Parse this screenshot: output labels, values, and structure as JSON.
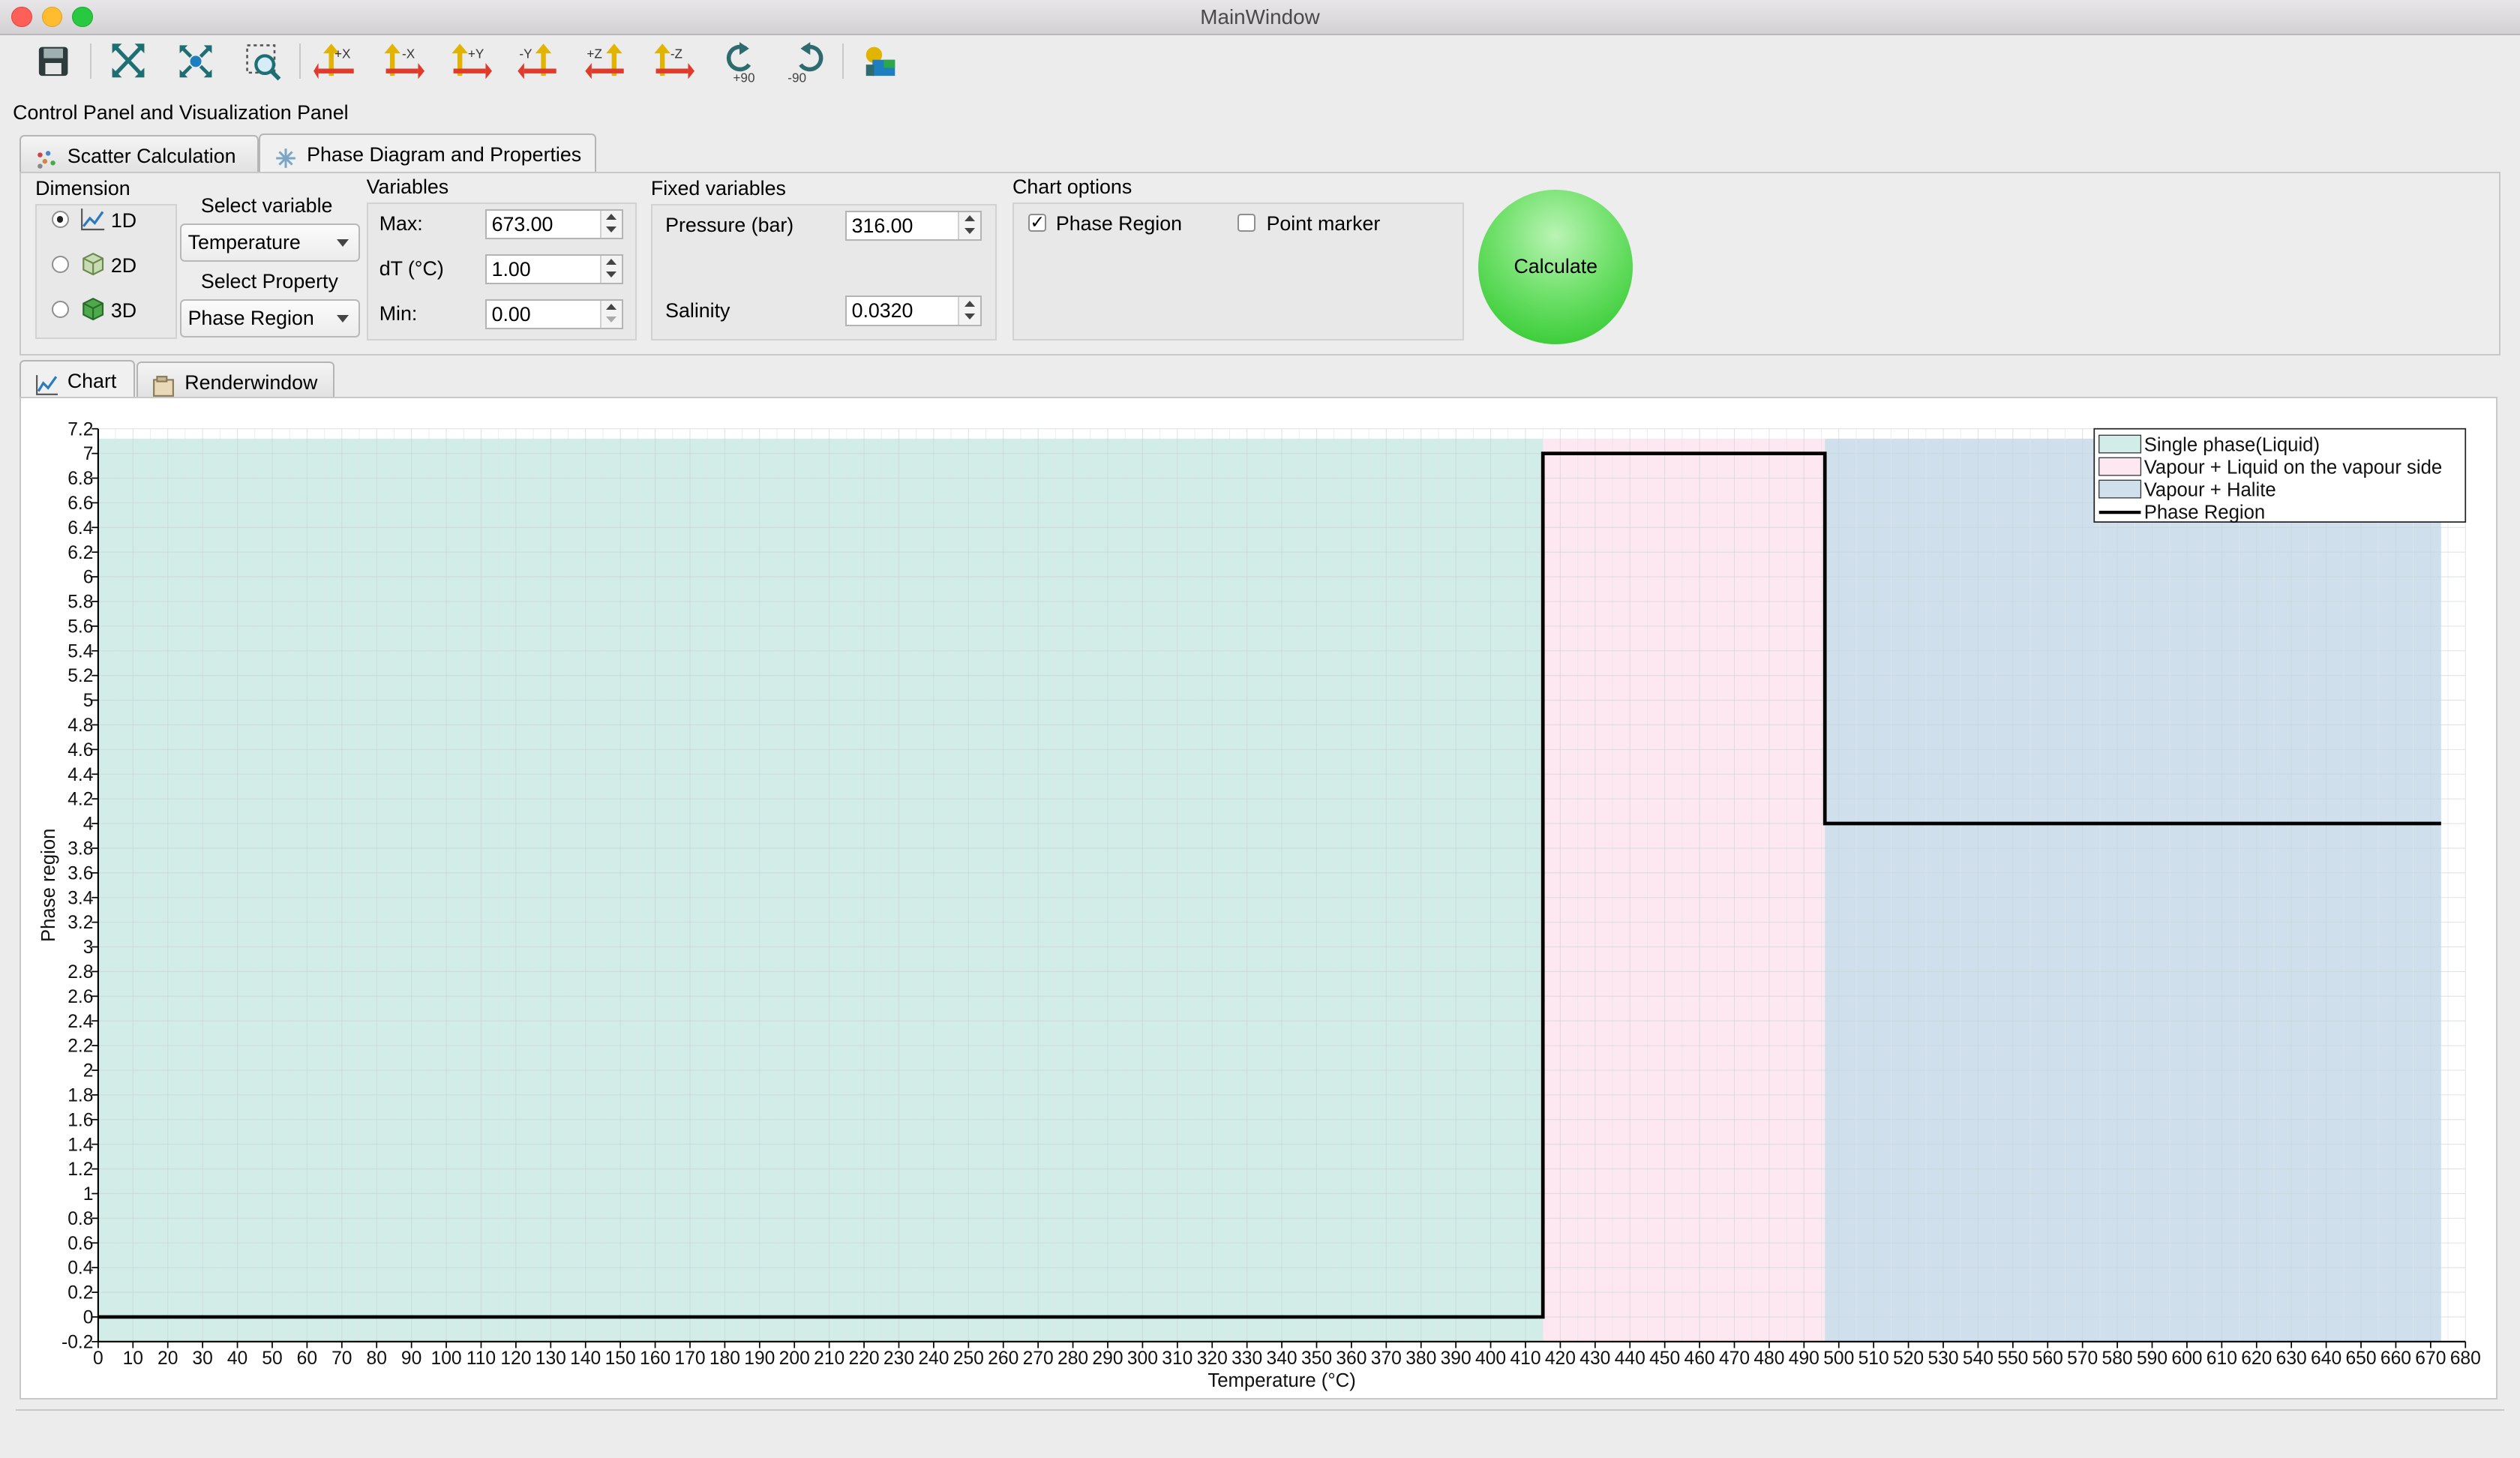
{
  "window": {
    "title": "MainWindow"
  },
  "toolbar": {
    "rotate_plus": "+90",
    "rotate_minus": "-90",
    "axes": [
      "+X",
      "-X",
      "+Y",
      "-Y",
      "+Z",
      "-Z"
    ]
  },
  "panel_title": "Control Panel and Visualization Panel",
  "top_tabs": [
    "Scatter Calculation",
    "Phase Diagram and Properties"
  ],
  "controls": {
    "dimension": {
      "label": "Dimension",
      "options": [
        "1D",
        "2D",
        "3D"
      ],
      "selected": "1D"
    },
    "select_variable": {
      "label": "Select variable",
      "value": "Temperature"
    },
    "select_property": {
      "label": "Select Property",
      "value": "Phase Region"
    },
    "variables": {
      "label": "Variables",
      "max_label": "Max:",
      "max_value": "673.00",
      "dt_label": "dT (°C)",
      "dt_value": "1.00",
      "min_label": "Min:",
      "min_value": "0.00"
    },
    "fixed": {
      "label": "Fixed variables",
      "pressure_label": "Pressure (bar)",
      "pressure_value": "316.00",
      "salinity_label": "Salinity",
      "salinity_value": "0.0320"
    },
    "chart_options": {
      "label": "Chart options",
      "phase_region_label": "Phase Region",
      "phase_region_checked": true,
      "point_marker_label": "Point marker",
      "point_marker_checked": false
    },
    "calculate_label": "Calculate"
  },
  "bottom_tabs": [
    "Chart",
    "Renderwindow"
  ],
  "chart_data": {
    "type": "line",
    "xlabel": "Temperature (°C)",
    "ylabel": "Phase region",
    "xlim": [
      0,
      680
    ],
    "ylim": [
      -0.2,
      7.2
    ],
    "x_ticks": [
      0,
      10,
      20,
      30,
      40,
      50,
      60,
      70,
      80,
      90,
      100,
      110,
      120,
      130,
      140,
      150,
      160,
      170,
      180,
      190,
      200,
      210,
      220,
      230,
      240,
      250,
      260,
      270,
      280,
      290,
      300,
      310,
      320,
      330,
      340,
      350,
      360,
      370,
      380,
      390,
      400,
      410,
      420,
      430,
      440,
      450,
      460,
      470,
      480,
      490,
      500,
      510,
      520,
      530,
      540,
      550,
      560,
      570,
      580,
      590,
      600,
      610,
      620,
      630,
      640,
      650,
      660,
      670,
      680
    ],
    "y_ticks": [
      -0.2,
      0,
      0.2,
      0.4,
      0.6,
      0.8,
      1,
      1.2,
      1.4,
      1.6,
      1.8,
      2,
      2.2,
      2.4,
      2.6,
      2.8,
      3,
      3.2,
      3.4,
      3.6,
      3.8,
      4,
      4.2,
      4.4,
      4.6,
      4.8,
      5,
      5.2,
      5.4,
      5.6,
      5.8,
      6,
      6.2,
      6.4,
      6.6,
      6.8,
      7,
      7.2
    ],
    "grid": true,
    "legend_position": "top-right",
    "regions": [
      {
        "name": "Single phase(Liquid)",
        "x0": 0,
        "x1": 415,
        "color": "#d2ece8"
      },
      {
        "name": "Vapour + Liquid on the vapour side",
        "x0": 415,
        "x1": 496,
        "color": "#fde8f1"
      },
      {
        "name": "Vapour + Halite",
        "x0": 496,
        "x1": 673,
        "color": "#cfe0ec"
      }
    ],
    "series": [
      {
        "name": "Phase Region",
        "color": "#000000",
        "x": [
          0,
          415,
          415,
          496,
          496,
          673
        ],
        "y": [
          0,
          0,
          7,
          7,
          4,
          4
        ]
      }
    ]
  }
}
